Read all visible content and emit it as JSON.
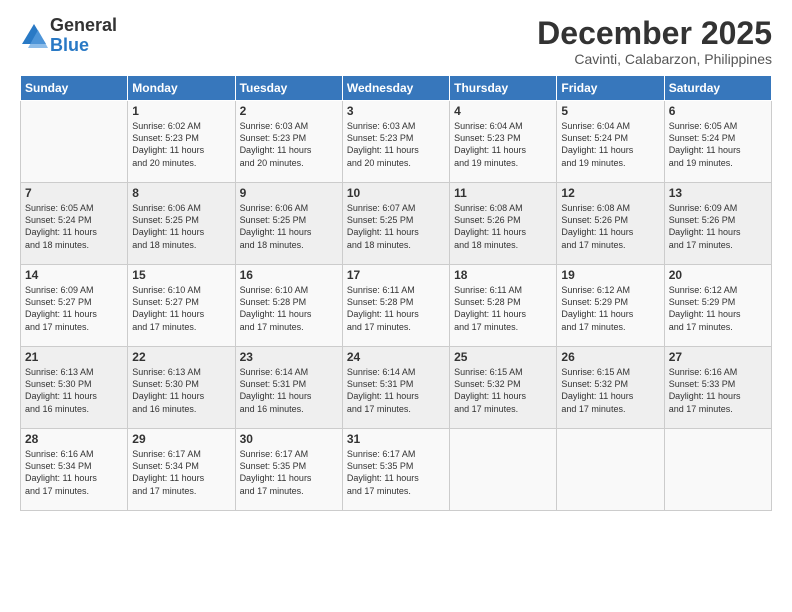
{
  "logo": {
    "general": "General",
    "blue": "Blue"
  },
  "header": {
    "month": "December 2025",
    "location": "Cavinti, Calabarzon, Philippines"
  },
  "days_of_week": [
    "Sunday",
    "Monday",
    "Tuesday",
    "Wednesday",
    "Thursday",
    "Friday",
    "Saturday"
  ],
  "weeks": [
    [
      {
        "day": "",
        "text": ""
      },
      {
        "day": "1",
        "text": "Sunrise: 6:02 AM\nSunset: 5:23 PM\nDaylight: 11 hours\nand 20 minutes."
      },
      {
        "day": "2",
        "text": "Sunrise: 6:03 AM\nSunset: 5:23 PM\nDaylight: 11 hours\nand 20 minutes."
      },
      {
        "day": "3",
        "text": "Sunrise: 6:03 AM\nSunset: 5:23 PM\nDaylight: 11 hours\nand 20 minutes."
      },
      {
        "day": "4",
        "text": "Sunrise: 6:04 AM\nSunset: 5:23 PM\nDaylight: 11 hours\nand 19 minutes."
      },
      {
        "day": "5",
        "text": "Sunrise: 6:04 AM\nSunset: 5:24 PM\nDaylight: 11 hours\nand 19 minutes."
      },
      {
        "day": "6",
        "text": "Sunrise: 6:05 AM\nSunset: 5:24 PM\nDaylight: 11 hours\nand 19 minutes."
      }
    ],
    [
      {
        "day": "7",
        "text": "Sunrise: 6:05 AM\nSunset: 5:24 PM\nDaylight: 11 hours\nand 18 minutes."
      },
      {
        "day": "8",
        "text": "Sunrise: 6:06 AM\nSunset: 5:25 PM\nDaylight: 11 hours\nand 18 minutes."
      },
      {
        "day": "9",
        "text": "Sunrise: 6:06 AM\nSunset: 5:25 PM\nDaylight: 11 hours\nand 18 minutes."
      },
      {
        "day": "10",
        "text": "Sunrise: 6:07 AM\nSunset: 5:25 PM\nDaylight: 11 hours\nand 18 minutes."
      },
      {
        "day": "11",
        "text": "Sunrise: 6:08 AM\nSunset: 5:26 PM\nDaylight: 11 hours\nand 18 minutes."
      },
      {
        "day": "12",
        "text": "Sunrise: 6:08 AM\nSunset: 5:26 PM\nDaylight: 11 hours\nand 17 minutes."
      },
      {
        "day": "13",
        "text": "Sunrise: 6:09 AM\nSunset: 5:26 PM\nDaylight: 11 hours\nand 17 minutes."
      }
    ],
    [
      {
        "day": "14",
        "text": "Sunrise: 6:09 AM\nSunset: 5:27 PM\nDaylight: 11 hours\nand 17 minutes."
      },
      {
        "day": "15",
        "text": "Sunrise: 6:10 AM\nSunset: 5:27 PM\nDaylight: 11 hours\nand 17 minutes."
      },
      {
        "day": "16",
        "text": "Sunrise: 6:10 AM\nSunset: 5:28 PM\nDaylight: 11 hours\nand 17 minutes."
      },
      {
        "day": "17",
        "text": "Sunrise: 6:11 AM\nSunset: 5:28 PM\nDaylight: 11 hours\nand 17 minutes."
      },
      {
        "day": "18",
        "text": "Sunrise: 6:11 AM\nSunset: 5:28 PM\nDaylight: 11 hours\nand 17 minutes."
      },
      {
        "day": "19",
        "text": "Sunrise: 6:12 AM\nSunset: 5:29 PM\nDaylight: 11 hours\nand 17 minutes."
      },
      {
        "day": "20",
        "text": "Sunrise: 6:12 AM\nSunset: 5:29 PM\nDaylight: 11 hours\nand 17 minutes."
      }
    ],
    [
      {
        "day": "21",
        "text": "Sunrise: 6:13 AM\nSunset: 5:30 PM\nDaylight: 11 hours\nand 16 minutes."
      },
      {
        "day": "22",
        "text": "Sunrise: 6:13 AM\nSunset: 5:30 PM\nDaylight: 11 hours\nand 16 minutes."
      },
      {
        "day": "23",
        "text": "Sunrise: 6:14 AM\nSunset: 5:31 PM\nDaylight: 11 hours\nand 16 minutes."
      },
      {
        "day": "24",
        "text": "Sunrise: 6:14 AM\nSunset: 5:31 PM\nDaylight: 11 hours\nand 17 minutes."
      },
      {
        "day": "25",
        "text": "Sunrise: 6:15 AM\nSunset: 5:32 PM\nDaylight: 11 hours\nand 17 minutes."
      },
      {
        "day": "26",
        "text": "Sunrise: 6:15 AM\nSunset: 5:32 PM\nDaylight: 11 hours\nand 17 minutes."
      },
      {
        "day": "27",
        "text": "Sunrise: 6:16 AM\nSunset: 5:33 PM\nDaylight: 11 hours\nand 17 minutes."
      }
    ],
    [
      {
        "day": "28",
        "text": "Sunrise: 6:16 AM\nSunset: 5:34 PM\nDaylight: 11 hours\nand 17 minutes."
      },
      {
        "day": "29",
        "text": "Sunrise: 6:17 AM\nSunset: 5:34 PM\nDaylight: 11 hours\nand 17 minutes."
      },
      {
        "day": "30",
        "text": "Sunrise: 6:17 AM\nSunset: 5:35 PM\nDaylight: 11 hours\nand 17 minutes."
      },
      {
        "day": "31",
        "text": "Sunrise: 6:17 AM\nSunset: 5:35 PM\nDaylight: 11 hours\nand 17 minutes."
      },
      {
        "day": "",
        "text": ""
      },
      {
        "day": "",
        "text": ""
      },
      {
        "day": "",
        "text": ""
      }
    ]
  ]
}
